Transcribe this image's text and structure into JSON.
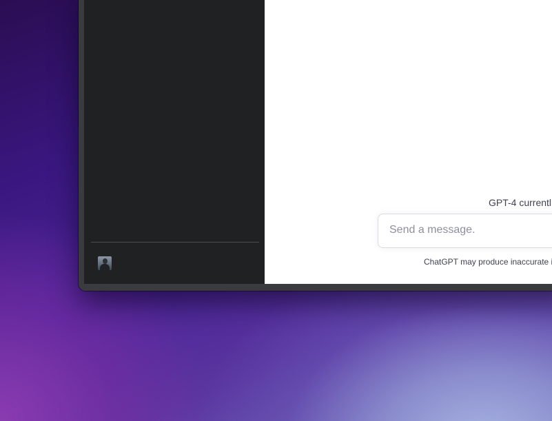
{
  "window": {
    "sidebar": {
      "user": {
        "avatar": "user-avatar-photo"
      }
    },
    "main": {
      "model_notice": "GPT-4 currentl",
      "composer": {
        "placeholder": "Send a message."
      },
      "disclaimer": "ChatGPT may produce inaccurate i"
    }
  },
  "colors": {
    "sidebar_bg": "#202123",
    "main_bg": "#ffffff",
    "window_frame": "#3a3b3e",
    "placeholder": "#8e8ea0"
  }
}
